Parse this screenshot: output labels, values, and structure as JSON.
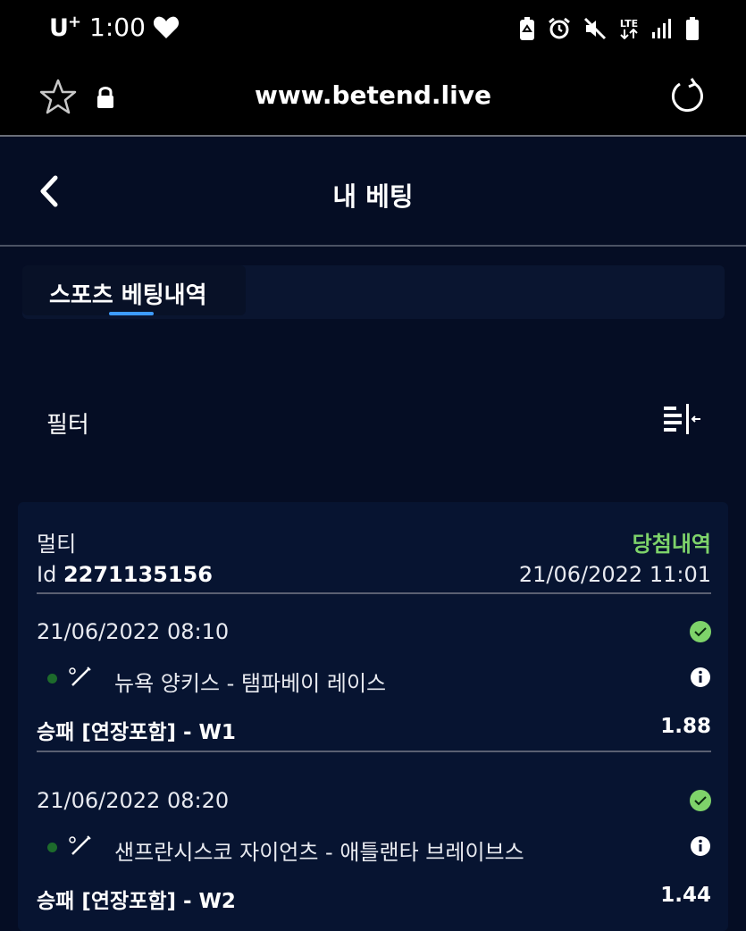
{
  "status_bar": {
    "carrier": "U",
    "carrier_sup": "+",
    "time": "1:00",
    "network": "LTE"
  },
  "browser": {
    "url": "www.betend.live"
  },
  "header": {
    "title": "내 베팅"
  },
  "tabs": [
    {
      "label": "스포츠 베팅내역",
      "active": true
    }
  ],
  "filter": {
    "label": "필터"
  },
  "bet": {
    "type": "멀티",
    "status": "당첨내역",
    "id_prefix": "Id",
    "id": "2271135156",
    "placed_at": "21/06/2022 11:01",
    "selections": [
      {
        "time": "21/06/2022 08:10",
        "match": "뉴욕 양키스 - 탬파베이 레이스",
        "market": "승패 [연장포함] - W1",
        "odds": "1.88"
      },
      {
        "time": "21/06/2022 08:20",
        "match": "샌프란시스코 자이언츠 - 애틀랜타 브레이브스",
        "market": "승패 [연장포함] - W2",
        "odds": "1.44"
      }
    ]
  },
  "colors": {
    "background": "#050d24",
    "card": "#071431",
    "win_green": "#7ed36a",
    "accent_blue": "#3d9bff"
  }
}
